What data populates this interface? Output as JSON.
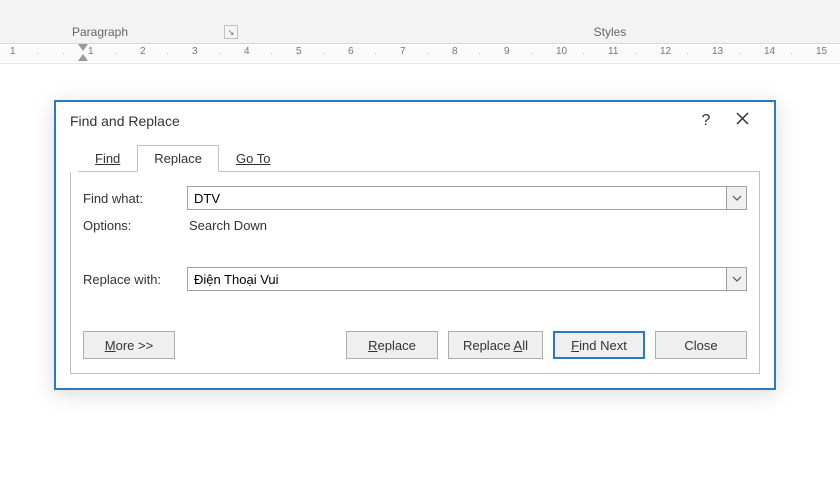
{
  "ribbon": {
    "groups": {
      "paragraph": "Paragraph",
      "styles": "Styles"
    }
  },
  "ruler": {
    "marks": [
      "1",
      "",
      "",
      "1",
      "",
      "2",
      "",
      "3",
      "",
      "4",
      "",
      "5",
      "",
      "6",
      "",
      "7",
      "",
      "8",
      "",
      "9",
      "",
      "10",
      "",
      "11",
      "",
      "12",
      "",
      "13",
      "",
      "14",
      "",
      "15"
    ]
  },
  "dialog": {
    "title": "Find and Replace",
    "help": "?",
    "tabs": {
      "find": "Find",
      "replace": "Replace",
      "goto": "Go To"
    },
    "labels": {
      "find_what": "Find what:",
      "options": "Options:",
      "replace_with": "Replace with:"
    },
    "values": {
      "find_what": "DTV",
      "options": "Search Down",
      "replace_with": "Điện Thoại Vui"
    },
    "buttons": {
      "more": "More >>",
      "replace": "Replace",
      "replace_all": "Replace All",
      "find_next": "Find Next",
      "close": "Close"
    }
  }
}
